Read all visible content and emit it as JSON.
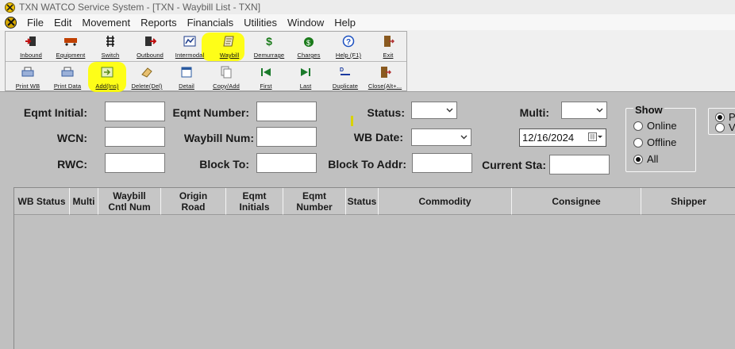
{
  "window": {
    "title": "TXN WATCO Service System - [TXN - Waybill List - TXN]"
  },
  "menu": [
    "File",
    "Edit",
    "Movement",
    "Reports",
    "Financials",
    "Utilities",
    "Window",
    "Help"
  ],
  "toolbar": {
    "row1": [
      {
        "label": "Inbound",
        "icon": "inbound-icon",
        "color": "#c01010"
      },
      {
        "label": "Equipment",
        "icon": "equipment-icon",
        "color": "#c04000"
      },
      {
        "label": "Switch",
        "icon": "switch-icon",
        "color": "#111111"
      },
      {
        "label": "Outbound",
        "icon": "outbound-icon",
        "color": "#c01010"
      },
      {
        "label": "Intermodal",
        "icon": "intermodal-icon",
        "color": "#1a3a8a"
      },
      {
        "label": "Waybill",
        "icon": "waybill-icon",
        "color": "#6b5a1e"
      },
      {
        "label": "Demurrage",
        "icon": "dollar-icon",
        "color": "#1a7a1a"
      },
      {
        "label": "Charges",
        "icon": "charges-icon",
        "color": "#1a7a1a"
      },
      {
        "label": "Help (F1)",
        "icon": "help-icon",
        "color": "#1a4fc0"
      },
      {
        "label": "Exit",
        "icon": "exit-icon",
        "color": "#b03030"
      }
    ],
    "row2": [
      {
        "label": "Print WB",
        "icon": "printer-icon",
        "color": "#3a5fa0"
      },
      {
        "label": "Print Data",
        "icon": "printer-icon",
        "color": "#3a5fa0"
      },
      {
        "label": "Add(Ins)",
        "icon": "add-icon",
        "color": "#5a8a1a"
      },
      {
        "label": "Delete(Del)",
        "icon": "eraser-icon",
        "color": "#c09030"
      },
      {
        "label": "Detail",
        "icon": "detail-icon",
        "color": "#2a5aa0"
      },
      {
        "label": "Copy/Add",
        "icon": "copy-icon",
        "color": "#808080"
      },
      {
        "label": "First",
        "icon": "first-icon",
        "color": "#1a7a2a"
      },
      {
        "label": "Last",
        "icon": "last-icon",
        "color": "#1a7a2a"
      },
      {
        "label": "Duplicate",
        "icon": "duplicate-icon",
        "color": "#1a3aa0"
      },
      {
        "label": "Close(Alt+...",
        "icon": "close-door-icon",
        "color": "#b03030"
      }
    ]
  },
  "form": {
    "eqmt_initial_label": "Eqmt Initial:",
    "eqmt_number_label": "Eqmt Number:",
    "status_label": "Status:",
    "multi_label": "Multi:",
    "wcn_label": "WCN:",
    "waybill_num_label": "Waybill Num:",
    "wb_date_label": "WB Date:",
    "wb_date_value": "12/16/2024",
    "rwc_label": "RWC:",
    "block_to_label": "Block To:",
    "block_to_addr_label": "Block To Addr:",
    "current_sta_label": "Current Sta:"
  },
  "show": {
    "legend": "Show",
    "options": [
      {
        "label": "Online",
        "selected": false
      },
      {
        "label": "Offline",
        "selected": false
      },
      {
        "label": "All",
        "selected": true
      }
    ],
    "side_options": [
      {
        "label": "P",
        "selected": true
      },
      {
        "label": "V",
        "selected": false
      }
    ]
  },
  "grid": {
    "columns": [
      "WB Status",
      "Multi",
      "Waybill\nCntl Num",
      "Origin\nRoad",
      "Eqmt\nInitials",
      "Eqmt\nNumber",
      "Status",
      "Commodity",
      "Consignee",
      "Shipper"
    ]
  },
  "highlight_color": "#ffff00"
}
